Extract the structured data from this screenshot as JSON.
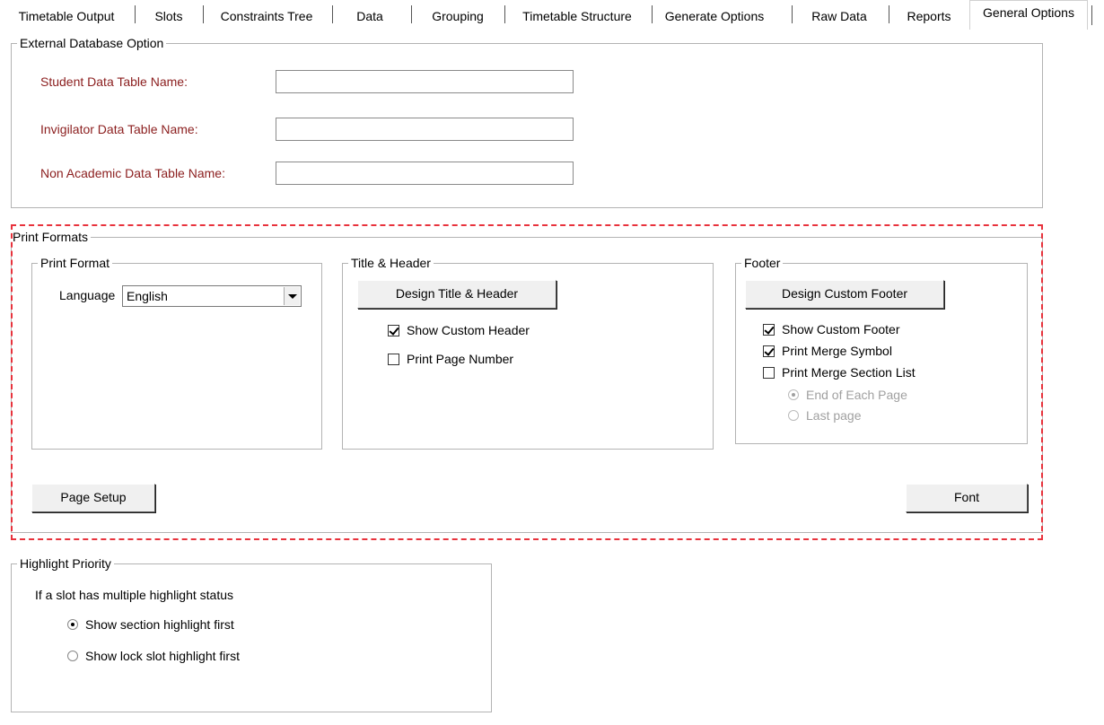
{
  "tabs": [
    {
      "label": "Timetable Output"
    },
    {
      "label": "Slots"
    },
    {
      "label": "Constraints Tree"
    },
    {
      "label": "Data"
    },
    {
      "label": "Grouping"
    },
    {
      "label": "Timetable Structure"
    },
    {
      "label": "Generate Options"
    },
    {
      "label": "Raw Data"
    },
    {
      "label": "Reports"
    },
    {
      "label": "General Options"
    }
  ],
  "selected_tab": "General Options",
  "external_db": {
    "title": "External Database Option",
    "student_label": "Student Data Table Name:",
    "student_value": "",
    "invigilator_label": "Invigilator Data Table Name:",
    "invigilator_value": "",
    "nonacademic_label": "Non Academic Data Table Name:",
    "nonacademic_value": ""
  },
  "print_formats": {
    "title": "Print Formats",
    "print_format": {
      "title": "Print Format",
      "language_label": "Language",
      "language_value": "English"
    },
    "title_header": {
      "title": "Title & Header",
      "design_button": "Design Title & Header",
      "show_custom_header": {
        "label": "Show Custom Header",
        "checked": true
      },
      "print_page_number": {
        "label": "Print Page Number",
        "checked": false
      }
    },
    "footer": {
      "title": "Footer",
      "design_button": "Design Custom Footer",
      "show_custom_footer": {
        "label": "Show Custom Footer",
        "checked": true
      },
      "print_merge_symbol": {
        "label": "Print Merge Symbol",
        "checked": true
      },
      "print_merge_section_list": {
        "label": "Print Merge Section List",
        "checked": false
      },
      "end_of_each_page": {
        "label": "End of Each Page",
        "selected": true
      },
      "last_page": {
        "label": "Last page",
        "selected": false
      }
    },
    "page_setup_button": "Page Setup",
    "font_button": "Font"
  },
  "highlight_priority": {
    "title": "Highlight Priority",
    "description": "If a slot has multiple highlight status",
    "section_first": {
      "label": "Show section highlight first",
      "selected": true
    },
    "lock_first": {
      "label": "Show lock slot highlight first",
      "selected": false
    }
  },
  "colors": {
    "label_red": "#8b1e1e",
    "highlight_dash": "#e8323c"
  }
}
